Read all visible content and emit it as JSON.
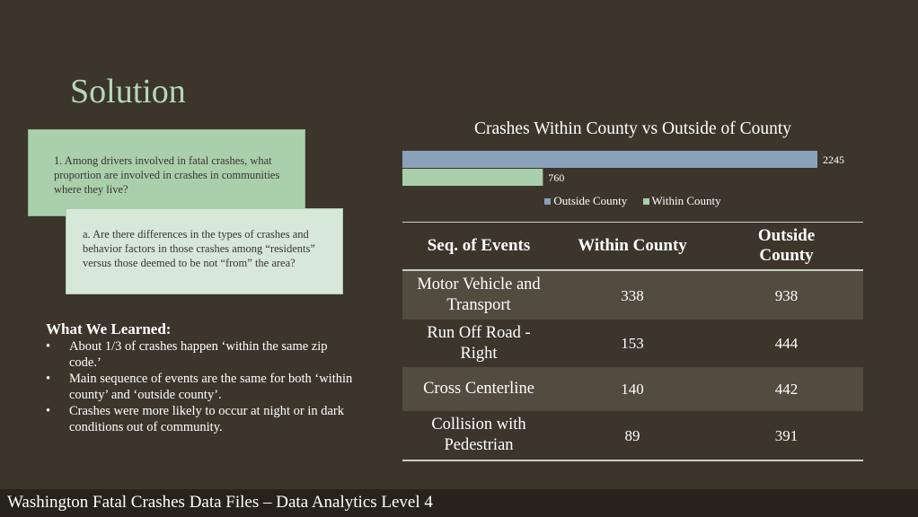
{
  "slide": {
    "title": "Solution",
    "question_1": "1.  Among drivers involved in fatal crashes, what proportion are involved in crashes in communities where they live?",
    "question_a": "a.  Are there differences in the types of crashes and behavior factors in those crashes among “residents” versus those deemed to be not “from” the area?",
    "learned_heading": "What We Learned:",
    "learned_items": [
      "About 1/3 of crashes happen ‘within the same zip code.’",
      "Main sequence of events are the same for both ‘within county’ and ‘outside county’.",
      "Crashes were more likely to occur at night or in dark conditions out of community."
    ],
    "footer": "Washington Fatal Crashes Data Files – Data Analytics Level 4"
  },
  "chart_data": [
    {
      "type": "bar",
      "orientation": "horizontal",
      "title": "Crashes Within County vs Outside of County",
      "series": [
        {
          "name": "Outside County",
          "values": [
            2245
          ],
          "color": "#8aa1ba"
        },
        {
          "name": "Within County",
          "values": [
            760
          ],
          "color": "#a9cfab"
        }
      ],
      "data_labels": true,
      "legend": "bottom",
      "grid": false,
      "xlim": [
        0,
        2245
      ]
    },
    {
      "type": "table",
      "columns": [
        "Seq. of Events",
        "Within County",
        "Outside County"
      ],
      "rows": [
        [
          "Motor Vehicle and Transport",
          "338",
          "938"
        ],
        [
          "Run Off Road - Right",
          "153",
          "444"
        ],
        [
          "Cross Centerline",
          "140",
          "442"
        ],
        [
          "Collision with Pedestrian",
          "89",
          "391"
        ]
      ]
    }
  ]
}
